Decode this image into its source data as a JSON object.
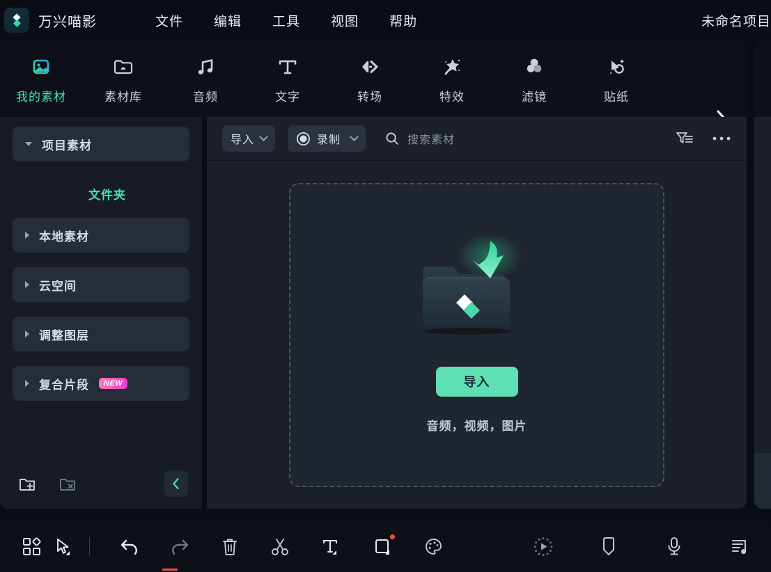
{
  "titlebar": {
    "logo_icon": "filmora-diamond-logo",
    "brand": "万兴喵影",
    "menus": [
      {
        "label": "文件",
        "name": "menu-file"
      },
      {
        "label": "编辑",
        "name": "menu-edit"
      },
      {
        "label": "工具",
        "name": "menu-tools"
      },
      {
        "label": "视图",
        "name": "menu-view"
      },
      {
        "label": "帮助",
        "name": "menu-help"
      }
    ],
    "project_title": "未命名项目"
  },
  "nav": {
    "active_color": "#4ce0b3",
    "tabs": [
      {
        "label": "我的素材",
        "icon": "image-media-icon",
        "active": true
      },
      {
        "label": "素材库",
        "icon": "folder-cloud-icon",
        "active": false
      },
      {
        "label": "音频",
        "icon": "music-note-icon",
        "active": false
      },
      {
        "label": "文字",
        "icon": "text-t-icon",
        "active": false
      },
      {
        "label": "转场",
        "icon": "transition-arrows-icon",
        "active": false
      },
      {
        "label": "特效",
        "icon": "magic-wand-star-icon",
        "active": false
      },
      {
        "label": "滤镜",
        "icon": "filter-circles-icon",
        "active": false
      },
      {
        "label": "贴纸",
        "icon": "sticker-shapes-icon",
        "active": false
      }
    ],
    "more_icon": "chevron-right-icon"
  },
  "sidebar": {
    "items": [
      {
        "label": "项目素材",
        "expanded": true,
        "accent": false,
        "badge": null
      },
      {
        "label": "文件夹",
        "expanded": null,
        "accent": true,
        "badge": null
      },
      {
        "label": "本地素材",
        "expanded": false,
        "accent": false,
        "badge": null
      },
      {
        "label": "云空间",
        "expanded": false,
        "accent": false,
        "badge": null
      },
      {
        "label": "调整图层",
        "expanded": false,
        "accent": false,
        "badge": null
      },
      {
        "label": "复合片段",
        "expanded": false,
        "accent": false,
        "badge": "NEW"
      }
    ],
    "footer": {
      "new_folder_icon": "folder-add-icon",
      "delete_folder_icon": "folder-remove-icon",
      "collapse_icon": "chevron-left-icon"
    }
  },
  "content_toolbar": {
    "import_label": "导入",
    "import_dropdown_icon": "chevron-down-icon",
    "record_label": "录制",
    "record_icon": "record-circle-icon",
    "record_dropdown_icon": "chevron-down-icon",
    "search_icon": "search-icon",
    "search_placeholder": "搜索素材",
    "filter_icon": "filter-list-icon",
    "more_icon": "more-dots-icon"
  },
  "dropzone": {
    "art_icon": "folder-with-download-arrow-illustration",
    "button_label": "导入",
    "hint": "音频，视频，图片",
    "accent": "#5fe0b4"
  },
  "bottombar": {
    "left_tools": [
      {
        "label": "",
        "icon": "grid-layout-icon",
        "name": "tool-layout"
      },
      {
        "label": "",
        "icon": "cursor-select-icon",
        "name": "tool-select"
      }
    ],
    "edit_tools": [
      {
        "label": "",
        "icon": "undo-icon",
        "name": "tool-undo"
      },
      {
        "label": "",
        "icon": "redo-icon",
        "name": "tool-redo"
      },
      {
        "label": "",
        "icon": "trash-delete-icon",
        "name": "tool-delete"
      },
      {
        "label": "",
        "icon": "scissors-split-icon",
        "name": "tool-split"
      },
      {
        "label": "",
        "icon": "text-t-icon",
        "name": "tool-text"
      },
      {
        "label": "",
        "icon": "crop-square-icon",
        "name": "tool-crop",
        "badge": true
      },
      {
        "label": "",
        "icon": "color-palette-icon",
        "name": "tool-color"
      }
    ],
    "right_tools": [
      {
        "label": "",
        "icon": "render-preview-icon",
        "name": "tool-render"
      },
      {
        "label": "",
        "icon": "marker-flag-icon",
        "name": "tool-marker"
      },
      {
        "label": "",
        "icon": "microphone-icon",
        "name": "tool-voiceover"
      },
      {
        "label": "",
        "icon": "audio-mixer-icon",
        "name": "tool-audio-mixer"
      }
    ]
  }
}
